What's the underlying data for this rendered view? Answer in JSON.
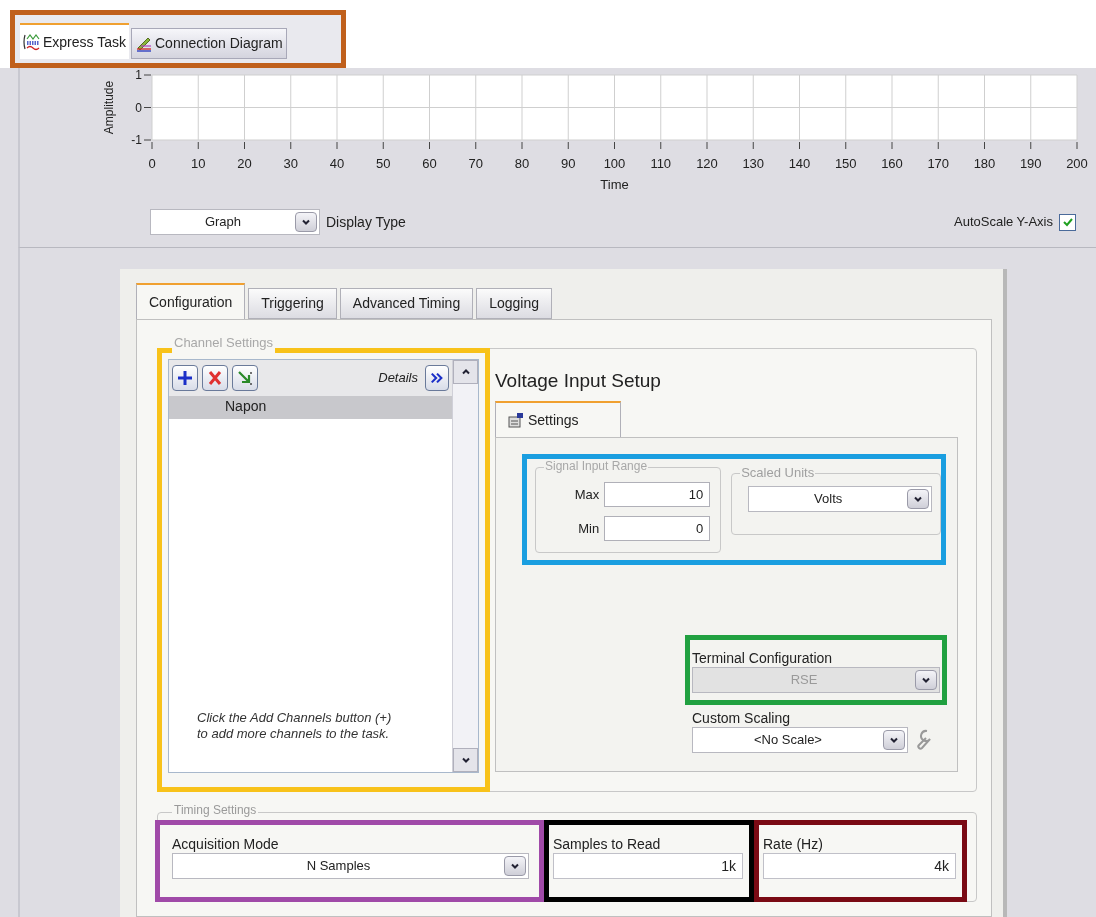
{
  "express_tabs": {
    "color": "#c0601c",
    "tabs": [
      {
        "kind": "express",
        "label": "Express Task",
        "selected": true
      },
      {
        "kind": "diagram",
        "label": "Connection Diagram",
        "selected": false
      }
    ]
  },
  "graph": {
    "chart_data": {
      "type": "line",
      "xlabel": "Time",
      "ylabel": "Amplitude",
      "grid": true,
      "xlim": [
        0,
        200
      ],
      "ylim": [
        -1,
        1
      ],
      "xticks": [
        0,
        10,
        20,
        30,
        40,
        50,
        60,
        70,
        80,
        90,
        100,
        110,
        120,
        130,
        140,
        150,
        160,
        170,
        180,
        190,
        200
      ],
      "yticks": [
        -1,
        0,
        1
      ]
    }
  },
  "display_type": {
    "value": "Graph",
    "label": "Display Type"
  },
  "autoscale": {
    "label": "AutoScale Y-Axis",
    "checked": true
  },
  "tabs": [
    {
      "label": "Configuration",
      "selected": true
    },
    {
      "label": "Triggering",
      "selected": false
    },
    {
      "label": "Advanced Timing",
      "selected": false
    },
    {
      "label": "Logging",
      "selected": false
    }
  ],
  "channel_settings": {
    "title": "Channel Settings",
    "color": "#f8c21a",
    "details_label": "Details",
    "channels": [
      {
        "name": "Napon",
        "selected": true
      }
    ],
    "hint": "Click the Add Channels button (+) to add more channels to the task."
  },
  "setup": {
    "title": "Voltage Input Setup",
    "tabs": [
      {
        "label": "Settings",
        "selected": true
      }
    ],
    "signal_input_range": {
      "title": "Signal Input Range",
      "color": "#1a9ee0",
      "max_label": "Max",
      "max": "10",
      "min_label": "Min",
      "min": "0"
    },
    "scaled_units": {
      "title": "Scaled Units",
      "value": "Volts"
    },
    "terminal_configuration": {
      "label": "Terminal Configuration",
      "value": "RSE",
      "disabled": true,
      "color": "#20a040"
    },
    "custom_scaling": {
      "label": "Custom Scaling",
      "value": "<No Scale>",
      "disabled": false
    }
  },
  "timing_settings": {
    "title": "Timing Settings",
    "acquisition_mode": {
      "label": "Acquisition Mode",
      "value": "N Samples",
      "color": "#a04aa8"
    },
    "samples_to_read": {
      "label": "Samples to Read",
      "value": "1k",
      "color": "#000000"
    },
    "rate": {
      "label": "Rate (Hz)",
      "value": "4k",
      "color": "#7a0a14"
    }
  }
}
